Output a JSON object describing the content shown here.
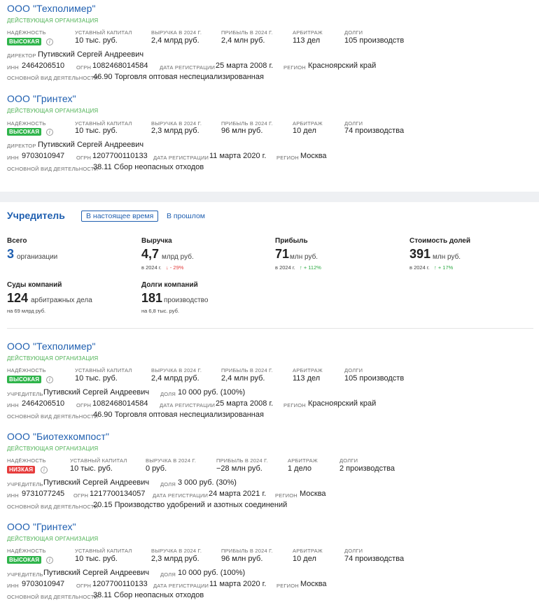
{
  "top_list": [
    {
      "name": "ООО \"Техполимер\"",
      "status": "ДЕЙСТВУЮЩАЯ ОРГАНИЗАЦИЯ",
      "reliability_label": "НАДЁЖНОСТЬ",
      "reliability": "ВЫСОКАЯ",
      "capital_label": "УСТАВНЫЙ КАПИТАЛ",
      "capital": "10 тыс. руб.",
      "revenue_label": "ВЫРУЧКА В 2024 Г.",
      "revenue": "2,4 млрд руб.",
      "profit_label": "ПРИБЫЛЬ В 2024 Г.",
      "profit": "2,4 млн руб.",
      "arbitration_label": "АРБИТРАЖ",
      "arbitration": "113 дел",
      "debts_label": "ДОЛГИ",
      "debts": "105 производств",
      "person_label": "ДИРЕКТОР",
      "person": "Путивский Сергей Андреевич",
      "inn_label": "ИНН",
      "inn": "2464206510",
      "ogrn_label": "ОГРН",
      "ogrn": "1082468014584",
      "reg_label": "ДАТА РЕГИСТРАЦИИ",
      "reg": "25 марта 2008 г.",
      "region_label": "РЕГИОН",
      "region": "Красноярский край",
      "activity_label": "ОСНОВНОЙ ВИД ДЕЯТЕЛЬНОСТИ",
      "activity": "46.90 Торговля оптовая неспециализированная"
    },
    {
      "name": "ООО \"Гринтех\"",
      "status": "ДЕЙСТВУЮЩАЯ ОРГАНИЗАЦИЯ",
      "reliability_label": "НАДЁЖНОСТЬ",
      "reliability": "ВЫСОКАЯ",
      "capital_label": "УСТАВНЫЙ КАПИТАЛ",
      "capital": "10 тыс. руб.",
      "revenue_label": "ВЫРУЧКА В 2024 Г.",
      "revenue": "2,3 млрд руб.",
      "profit_label": "ПРИБЫЛЬ В 2024 Г.",
      "profit": "96 млн руб.",
      "arbitration_label": "АРБИТРАЖ",
      "arbitration": "10 дел",
      "debts_label": "ДОЛГИ",
      "debts": "74 производства",
      "person_label": "ДИРЕКТОР",
      "person": "Путивский Сергей Андреевич",
      "inn_label": "ИНН",
      "inn": "9703010947",
      "ogrn_label": "ОГРН",
      "ogrn": "1207700110133",
      "reg_label": "ДАТА РЕГИСТРАЦИИ",
      "reg": "11 марта 2020 г.",
      "region_label": "РЕГИОН",
      "region": "Москва",
      "activity_label": "ОСНОВНОЙ ВИД ДЕЯТЕЛЬНОСТИ",
      "activity": "38.11 Сбор неопасных отходов"
    }
  ],
  "founder": {
    "title": "Учредитель",
    "tab_current": "В настоящее время",
    "tab_past": "В прошлом",
    "stats": {
      "total_label": "Всего",
      "total_value": "3",
      "total_unit": "организации",
      "revenue_label": "Выручка",
      "revenue_value": "4,7",
      "revenue_unit": "млрд руб.",
      "revenue_sub": "в 2024 г.",
      "revenue_change": "↓ - 29%",
      "profit_label": "Прибыль",
      "profit_value": "71",
      "profit_unit": "млн руб.",
      "profit_sub": "в 2024 г.",
      "profit_change": "↑ + 112%",
      "shares_label": "Стоимость долей",
      "shares_value": "391",
      "shares_unit": "млн руб.",
      "shares_sub": "в 2024 г.",
      "shares_change": "↑ + 17%",
      "courts_label": "Суды компаний",
      "courts_value": "124",
      "courts_unit": "арбитражных дела",
      "courts_sub": "на 69 млрд руб.",
      "debts_label": "Долги компаний",
      "debts_value": "181",
      "debts_unit": "производство",
      "debts_sub": "на 6,8 тыс. руб."
    }
  },
  "founder_list": [
    {
      "name": "ООО \"Техполимер\"",
      "status": "ДЕЙСТВУЮЩАЯ ОРГАНИЗАЦИЯ",
      "reliability_label": "НАДЁЖНОСТЬ",
      "reliability": "ВЫСОКАЯ",
      "capital_label": "УСТАВНЫЙ КАПИТАЛ",
      "capital": "10 тыс. руб.",
      "revenue_label": "ВЫРУЧКА В 2024 Г.",
      "revenue": "2,4 млрд руб.",
      "profit_label": "ПРИБЫЛЬ В 2024 Г.",
      "profit": "2,4 млн руб.",
      "arbitration_label": "АРБИТРАЖ",
      "arbitration": "113 дел",
      "debts_label": "ДОЛГИ",
      "debts": "105 производств",
      "person_label": "УЧРЕДИТЕЛЬ",
      "person": "Путивский Сергей Андреевич",
      "share_label": "ДОЛЯ",
      "share": "10 000 руб. (100%)",
      "inn_label": "ИНН",
      "inn": "2464206510",
      "ogrn_label": "ОГРН",
      "ogrn": "1082468014584",
      "reg_label": "ДАТА РЕГИСТРАЦИИ",
      "reg": "25 марта 2008 г.",
      "region_label": "РЕГИОН",
      "region": "Красноярский край",
      "activity_label": "ОСНОВНОЙ ВИД ДЕЯТЕЛЬНОСТИ",
      "activity": "46.90 Торговля оптовая неспециализированная"
    },
    {
      "name": "ООО \"Биотехкомпост\"",
      "status": "ДЕЙСТВУЮЩАЯ ОРГАНИЗАЦИЯ",
      "reliability_label": "НАДЁЖНОСТЬ",
      "reliability": "НИЗКАЯ",
      "capital_label": "УСТАВНЫЙ КАПИТАЛ",
      "capital": "10 тыс. руб.",
      "revenue_label": "ВЫРУЧКА В 2024 Г.",
      "revenue": "0 руб.",
      "profit_label": "ПРИБЫЛЬ В 2024 Г.",
      "profit": "−28 млн руб.",
      "arbitration_label": "АРБИТРАЖ",
      "arbitration": "1 дело",
      "debts_label": "ДОЛГИ",
      "debts": "2 производства",
      "person_label": "УЧРЕДИТЕЛЬ",
      "person": "Путивский Сергей Андреевич",
      "share_label": "ДОЛЯ",
      "share": "3 000 руб. (30%)",
      "inn_label": "ИНН",
      "inn": "9731077245",
      "ogrn_label": "ОГРН",
      "ogrn": "1217700134057",
      "reg_label": "ДАТА РЕГИСТРАЦИИ",
      "reg": "24 марта 2021 г.",
      "region_label": "РЕГИОН",
      "region": "Москва",
      "activity_label": "ОСНОВНОЙ ВИД ДЕЯТЕЛЬНОСТИ",
      "activity": "20.15 Производство удобрений и азотных соединений"
    },
    {
      "name": "ООО \"Гринтех\"",
      "status": "ДЕЙСТВУЮЩАЯ ОРГАНИЗАЦИЯ",
      "reliability_label": "НАДЁЖНОСТЬ",
      "reliability": "ВЫСОКАЯ",
      "capital_label": "УСТАВНЫЙ КАПИТАЛ",
      "capital": "10 тыс. руб.",
      "revenue_label": "ВЫРУЧКА В 2024 Г.",
      "revenue": "2,3 млрд руб.",
      "profit_label": "ПРИБЫЛЬ В 2024 Г.",
      "profit": "96 млн руб.",
      "arbitration_label": "АРБИТРАЖ",
      "arbitration": "10 дел",
      "debts_label": "ДОЛГИ",
      "debts": "74 производства",
      "person_label": "УЧРЕДИТЕЛЬ",
      "person": "Путивский Сергей Андреевич",
      "share_label": "ДОЛЯ",
      "share": "10 000 руб. (100%)",
      "inn_label": "ИНН",
      "inn": "9703010947",
      "ogrn_label": "ОГРН",
      "ogrn": "1207700110133",
      "reg_label": "ДАТА РЕГИСТРАЦИИ",
      "reg": "11 марта 2020 г.",
      "region_label": "РЕГИОН",
      "region": "Москва",
      "activity_label": "ОСНОВНОЙ ВИД ДЕЯТЕЛЬНОСТИ",
      "activity": "38.11 Сбор неопасных отходов"
    }
  ]
}
